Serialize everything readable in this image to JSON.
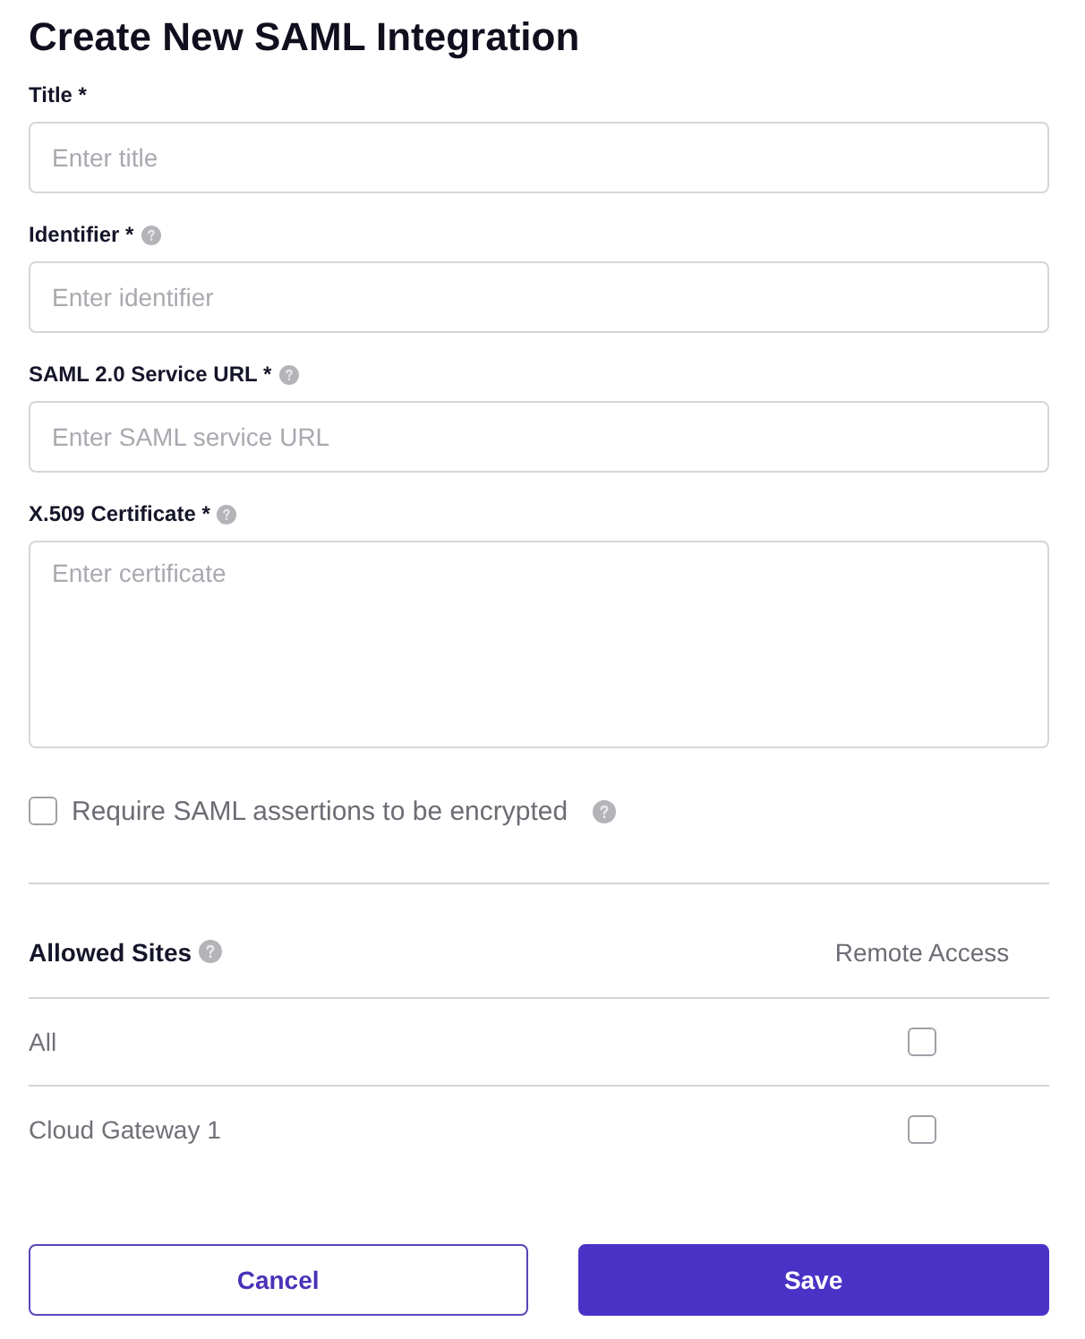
{
  "title": "Create New SAML Integration",
  "fields": [
    {
      "kind": "input",
      "label": "Title *",
      "help": false,
      "placeholder": "Enter title"
    },
    {
      "kind": "input",
      "label": "Identifier *",
      "help": true,
      "placeholder": "Enter identifier"
    },
    {
      "kind": "input",
      "label": "SAML 2.0 Service URL *",
      "help": true,
      "placeholder": "Enter SAML service URL"
    },
    {
      "kind": "textarea",
      "label": "X.509 Certificate *",
      "help": true,
      "placeholder": "Enter certificate"
    }
  ],
  "encrypt_option": {
    "label": "Require SAML assertions to be encrypted",
    "checked": false,
    "help": true
  },
  "sites": {
    "columns": [
      {
        "label": "Allowed Sites",
        "help": true
      },
      {
        "label": "Remote Access",
        "help": false
      }
    ],
    "rows": [
      {
        "name": "All",
        "remote_access": false
      },
      {
        "name": "Cloud Gateway 1",
        "remote_access": false
      }
    ]
  },
  "buttons": [
    {
      "kind": "secondary",
      "label": "Cancel"
    },
    {
      "kind": "primary",
      "label": "Save"
    }
  ]
}
